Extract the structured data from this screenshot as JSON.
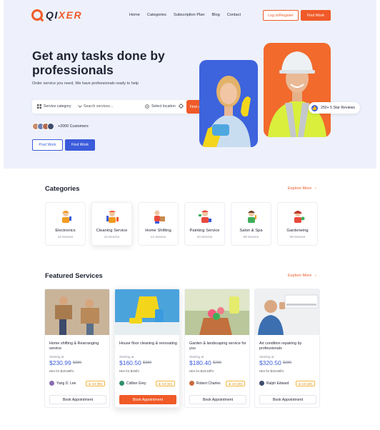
{
  "brand": {
    "name_a": "QI",
    "name_b": "XER"
  },
  "nav": [
    "Home",
    "Categories",
    "Subscription Plan",
    "Blog",
    "Contact"
  ],
  "header": {
    "login_label": "Log in/Register",
    "findwork_label": "Find Work"
  },
  "hero": {
    "title": "Get any tasks done by professionals",
    "subtitle": "Order service you need, We have professionals ready to help",
    "search": {
      "category_label": "Service category",
      "search_placeholder": "Search services...",
      "location_label": "Select location",
      "find_label": "Find a Professional"
    },
    "customers_label": "+2000 Customers",
    "post_work_label": "Post Work",
    "find_work_label": "Find Work",
    "reviews_label": "250+ 5 Star Reviews"
  },
  "categories": {
    "title": "Categories",
    "explore_label": "Explore More",
    "items": [
      {
        "name": "Electronics",
        "count": "16 Service"
      },
      {
        "name": "Cleaning Service",
        "count": "13 Service"
      },
      {
        "name": "Home Shifting",
        "count": "14 Service"
      },
      {
        "name": "Painting Service",
        "count": "10 Service"
      },
      {
        "name": "Salon & Spa",
        "count": "08 Service"
      },
      {
        "name": "Gardeneing",
        "count": "08 Service"
      }
    ]
  },
  "featured": {
    "title": "Featured Services",
    "explore_label": "Explore More",
    "items": [
      {
        "title": "Home shifting & Rearranging service",
        "start": "Starting at",
        "price": "$230.99",
        "old": "$380",
        "hire": "Hire for $19.59/hr",
        "provider": "Yang D. Lee",
        "rating": "4.8 (86)",
        "book": "Book Appointment"
      },
      {
        "title": "House floor cleaning & renovating",
        "start": "Starting at",
        "price": "$160.50",
        "old": "$380",
        "hire": "Hire for $19/hr",
        "provider": "Cidlion Grey",
        "rating": "4.9 (32)",
        "book": "Book Appointment"
      },
      {
        "title": "Garden & landscaping service for you",
        "start": "Starting at",
        "price": "$180.40",
        "old": "$280",
        "hire": "Hire for $19.33/hr",
        "provider": "Robert Charles",
        "rating": "4.8 (26)",
        "book": "Book Appointment"
      },
      {
        "title": "Air condition repairing by professionals",
        "start": "Starting at",
        "price": "$320.50",
        "old": "$380",
        "hire": "Hire for $19.59/hr",
        "provider": "Ralph Edward",
        "rating": "4.8 (28)",
        "book": "Book Appointment"
      }
    ]
  },
  "colors": {
    "accent": "#f05a28",
    "primary": "#3b5bdb",
    "hero_bg": "#eef1fb"
  },
  "icons": [
    "grid-icon",
    "chevron-down-icon",
    "location-pin-icon",
    "target-icon",
    "thumbs-up-icon",
    "chevron-right-icon",
    "star-icon"
  ]
}
